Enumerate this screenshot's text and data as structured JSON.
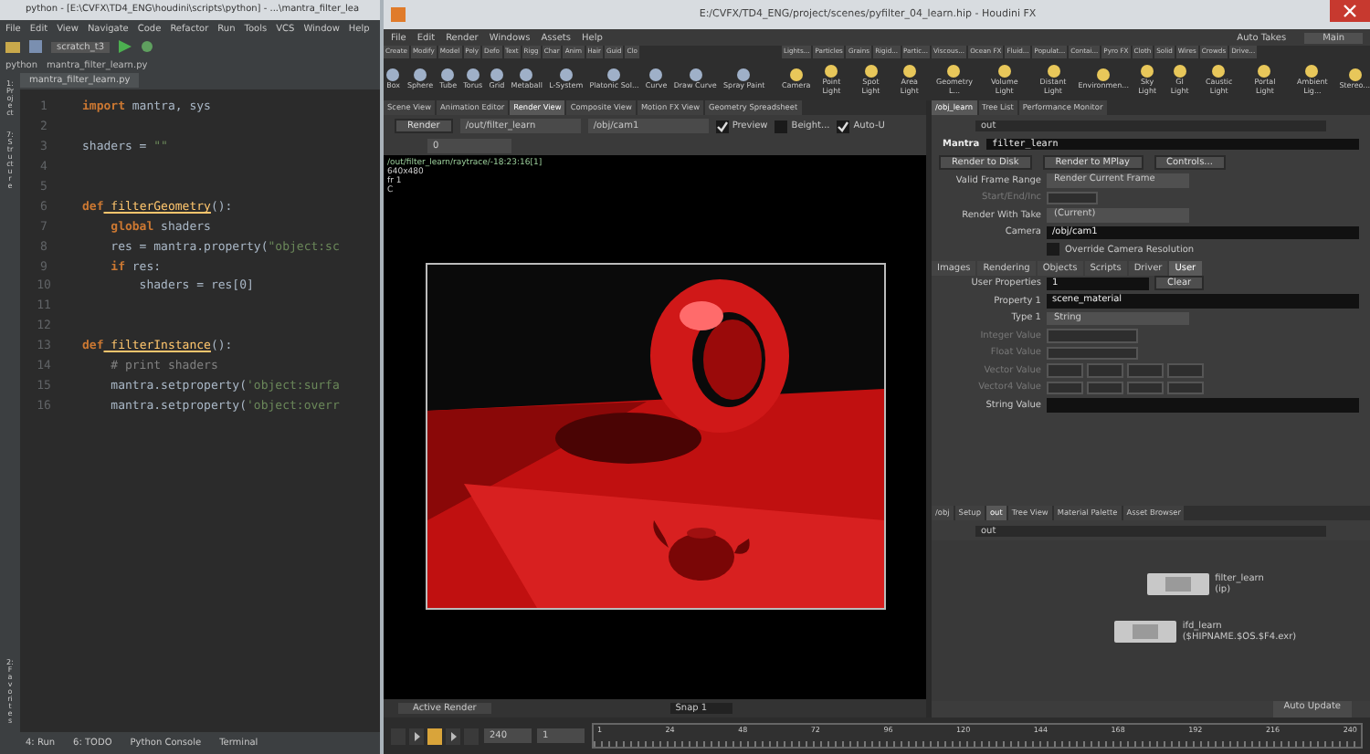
{
  "pycharm": {
    "title": "python - [E:\\CVFX\\TD4_ENG\\houdini\\scripts\\python] - ...\\mantra_filter_lea",
    "menu": [
      "File",
      "Edit",
      "View",
      "Navigate",
      "Code",
      "Refactor",
      "Run",
      "Tools",
      "VCS",
      "Window",
      "Help"
    ],
    "run_config": "scratch_t3",
    "breadcrumbs": [
      "python",
      "mantra_filter_learn.py"
    ],
    "file_tab": "mantra_filter_learn.py",
    "side_tabs": [
      "1: Project",
      "7: Structure"
    ],
    "bottom_side_tab": "2: Favorites",
    "code": [
      {
        "number": "1",
        "tokens": [
          {
            "kind": "kw",
            "text": "import"
          },
          {
            "kind": "plain",
            "text": " mantra, sys"
          }
        ]
      },
      {
        "number": "2"
      },
      {
        "number": "3",
        "tokens": [
          {
            "kind": "plain",
            "text": "shaders = "
          },
          {
            "kind": "str",
            "text": "\"\""
          }
        ]
      },
      {
        "number": "4"
      },
      {
        "number": "5"
      },
      {
        "number": "6",
        "tokens": [
          {
            "kind": "kw",
            "text": "def"
          },
          {
            "kind": "fn",
            "text": " filterGeometry"
          },
          {
            "kind": "plain",
            "text": "():"
          }
        ]
      },
      {
        "number": "7",
        "tokens": [
          {
            "kind": "kw",
            "text": "    global"
          },
          {
            "kind": "plain",
            "text": " shaders"
          }
        ]
      },
      {
        "number": "8",
        "tokens": [
          {
            "kind": "plain",
            "text": "    res = mantra.property("
          },
          {
            "kind": "str",
            "text": "\"object:sc"
          }
        ]
      },
      {
        "number": "9",
        "tokens": [
          {
            "kind": "kw",
            "text": "    if"
          },
          {
            "kind": "plain",
            "text": " res:"
          }
        ]
      },
      {
        "number": "10",
        "tokens": [
          {
            "kind": "plain",
            "text": "        shaders = res[0]"
          }
        ]
      },
      {
        "number": "11"
      },
      {
        "number": "12"
      },
      {
        "number": "13",
        "tokens": [
          {
            "kind": "kw",
            "text": "def"
          },
          {
            "kind": "fn",
            "text": " filterInstance"
          },
          {
            "kind": "plain",
            "text": "():"
          }
        ]
      },
      {
        "number": "14",
        "tokens": [
          {
            "kind": "comment",
            "text": "    # print shaders"
          }
        ]
      },
      {
        "number": "15",
        "tokens": [
          {
            "kind": "plain",
            "text": "    mantra.setproperty("
          },
          {
            "kind": "str",
            "text": "'object:surfa"
          }
        ]
      },
      {
        "number": "16",
        "tokens": [
          {
            "kind": "plain",
            "text": "    mantra.setproperty("
          },
          {
            "kind": "str",
            "text": "'object:overr"
          }
        ]
      }
    ],
    "tool_tabs": [
      "4: Run",
      "6: TODO",
      "Python Console",
      "Terminal"
    ]
  },
  "houdini": {
    "title": "E:/CVFX/TD4_ENG/project/scenes/pyfilter_04_learn.hip - Houdini FX",
    "menu": [
      "File",
      "Edit",
      "Render",
      "Windows",
      "Assets",
      "Help"
    ],
    "takes_label": "Auto Takes",
    "desktop": "Main",
    "shelf_tabs_left": [
      "Create",
      "Modify",
      "Model",
      "Poly",
      "Defo",
      "Text",
      "Rigg",
      "Char",
      "Anim",
      "Hair",
      "Guid",
      "Clo"
    ],
    "shelf_tabs_right": [
      "Lights...",
      "Particles",
      "Grains",
      "Rigid...",
      "Partic...",
      "Viscous...",
      "Ocean FX",
      "Fluid...",
      "Populat...",
      "Contai...",
      "Pyro FX",
      "Cloth",
      "Solid",
      "Wires",
      "Crowds",
      "Drive..."
    ],
    "tools_left": [
      "Box",
      "Sphere",
      "Tube",
      "Torus",
      "Grid",
      "Metaball",
      "L-System",
      "Platonic Sol...",
      "Curve",
      "Draw Curve",
      "Spray Paint"
    ],
    "tools_right": [
      "Camera",
      "Point Light",
      "Spot Light",
      "Area Light",
      "Geometry L...",
      "Volume Light",
      "Distant Light",
      "Environmen...",
      "Sky Light",
      "GI Light",
      "Caustic Light",
      "Portal Light",
      "Ambient Lig...",
      "Stereo..."
    ],
    "pane_tabs": [
      {
        "label": "Scene View",
        "selected": false
      },
      {
        "label": "Animation Editor",
        "selected": false
      },
      {
        "label": "Render View",
        "selected": true
      },
      {
        "label": "Composite View",
        "selected": false
      },
      {
        "label": "Motion FX View",
        "selected": false
      },
      {
        "label": "Geometry Spreadsheet",
        "selected": false
      }
    ],
    "render_button": "Render",
    "rop_path": "/out/filter_learn",
    "camera_path": "/obj/cam1",
    "toggles": [
      {
        "label": "Preview",
        "checked": true
      },
      {
        "label": "Beight...",
        "checked": false
      },
      {
        "label": "Auto-U",
        "checked": true
      }
    ],
    "snapshot_field": "0",
    "render_info": [
      "/out/filter_learn/raytrace/-18:23:16[1]",
      "640x480",
      "fr 1",
      "C"
    ],
    "param_tabs": [
      {
        "label": "/obj_learn",
        "selected": true
      },
      {
        "label": "Tree List",
        "selected": false
      },
      {
        "label": "Performance Monitor",
        "selected": false
      }
    ],
    "param_path": "out",
    "node_type": "Mantra",
    "node_name": "filter_learn",
    "node_buttons": [
      "Render to Disk",
      "Render to MPlay",
      "Controls..."
    ],
    "params": [
      {
        "kind": "menu",
        "label": "Valid Frame Range",
        "value": "Render Current Frame",
        "disabled": false
      },
      {
        "kind": "field",
        "label": "Start/End/Inc",
        "disabled": true
      },
      {
        "kind": "menu",
        "label": "Render With Take",
        "value": "(Current)",
        "disabled": false
      },
      {
        "kind": "field",
        "label": "Camera",
        "value": "/obj/cam1",
        "disabled": false
      },
      {
        "kind": "check",
        "label": "Override Camera Resolution",
        "checked": false,
        "disabled": false
      }
    ],
    "sub_tabs": [
      {
        "label": "Images",
        "selected": false
      },
      {
        "label": "Rendering",
        "selected": false
      },
      {
        "label": "Objects",
        "selected": false
      },
      {
        "label": "Scripts",
        "selected": false
      },
      {
        "label": "Driver",
        "selected": false
      },
      {
        "label": "User",
        "selected": true
      }
    ],
    "user_properties": {
      "label": "User Properties",
      "count": "1",
      "clear": "Clear"
    },
    "user_params": [
      {
        "kind": "field",
        "label": "Property 1",
        "value": "scene_material",
        "disabled": false
      },
      {
        "kind": "menu",
        "label": "Type 1",
        "value": "String",
        "disabled": false
      },
      {
        "kind": "field",
        "label": "Integer Value",
        "disabled": true
      },
      {
        "kind": "field",
        "label": "Float Value",
        "disabled": true
      },
      {
        "kind": "vector",
        "label": "Vector Value",
        "disabled": true
      },
      {
        "kind": "vector",
        "label": "Vector4 Value",
        "disabled": true
      },
      {
        "kind": "field",
        "label": "String Value",
        "disabled": false
      }
    ],
    "net_tabs": [
      {
        "label": "/obj",
        "selected": false
      },
      {
        "label": "Setup",
        "selected": false
      },
      {
        "label": "out",
        "selected": true
      },
      {
        "label": "Tree View",
        "selected": false
      },
      {
        "label": "Material Palette",
        "selected": false
      },
      {
        "label": "Asset Browser",
        "selected": false
      }
    ],
    "net_path": "out",
    "nodes": [
      {
        "name": "filter_learn",
        "detail": "(ip)"
      },
      {
        "name": "ifd_learn",
        "detail": "($HIPNAME.$OS.$F4.exr)"
      }
    ],
    "auto_update": "Auto Update",
    "active_render": "Active Render",
    "snap": "Snap 1",
    "end_frame": "240",
    "current_frame": "1",
    "ticks": [
      "1",
      "24",
      "48",
      "72",
      "96",
      "120",
      "144",
      "168",
      "192",
      "216",
      "240"
    ]
  }
}
